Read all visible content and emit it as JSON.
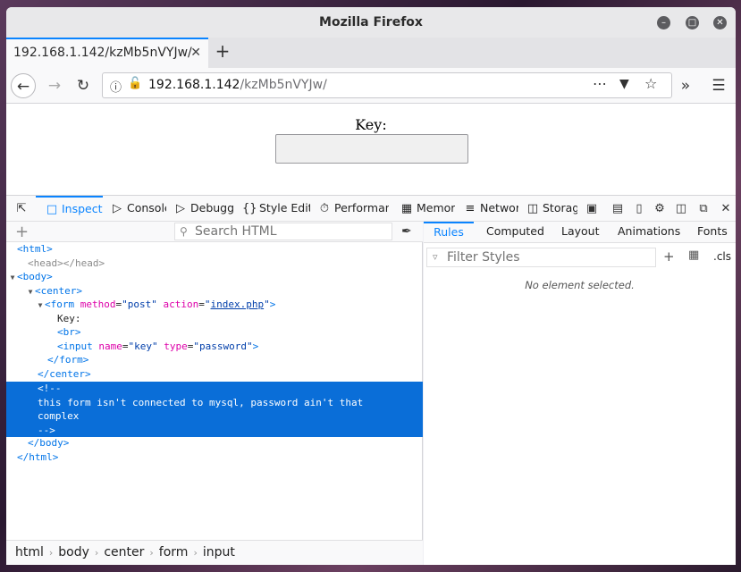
{
  "window": {
    "title": "Mozilla Firefox"
  },
  "tab": {
    "title": "192.168.1.142/kzMb5nVYJw/"
  },
  "urlbar": {
    "host": "192.168.1.142",
    "path": "/kzMb5nVYJw/"
  },
  "page": {
    "key_label": "Key:",
    "input_value": ""
  },
  "devtools": {
    "tabs": [
      "Inspector",
      "Console",
      "Debugger",
      "Style Editor",
      "Performance",
      "Memory",
      "Network",
      "Storage"
    ],
    "search_placeholder": "Search HTML",
    "side_tabs": [
      "Rules",
      "Computed",
      "Layout",
      "Animations",
      "Fonts"
    ],
    "filter_placeholder": "Filter Styles",
    "cls_label": ".cls",
    "empty_message": "No element selected.",
    "breadcrumbs": [
      "html",
      "body",
      "center",
      "form",
      "input"
    ]
  },
  "markup": {
    "html_open": "html",
    "head": "head",
    "body_open": "body",
    "center_open": "center",
    "form_tag": "form",
    "form_method_attr": "method",
    "form_method_val": "post",
    "form_action_attr": "action",
    "form_action_val": "index.php",
    "key_text": "Key:",
    "br_tag": "br",
    "input_tag": "input",
    "input_name_attr": "name",
    "input_name_val": "key",
    "input_type_attr": "type",
    "input_type_val": "password",
    "form_close": "form",
    "center_close": "center",
    "comment_open": "<!--",
    "comment_line1": "this form isn't connected to mysql, password ain't that",
    "comment_line2": "complex",
    "comment_close": "-->",
    "body_close": "body",
    "html_close": "html"
  },
  "colors": {
    "accent": "#0a84ff",
    "selection": "#0a6ed8",
    "tag": "#0074e8",
    "attr_name": "#dd00a9",
    "attr_value": "#003eaa"
  }
}
